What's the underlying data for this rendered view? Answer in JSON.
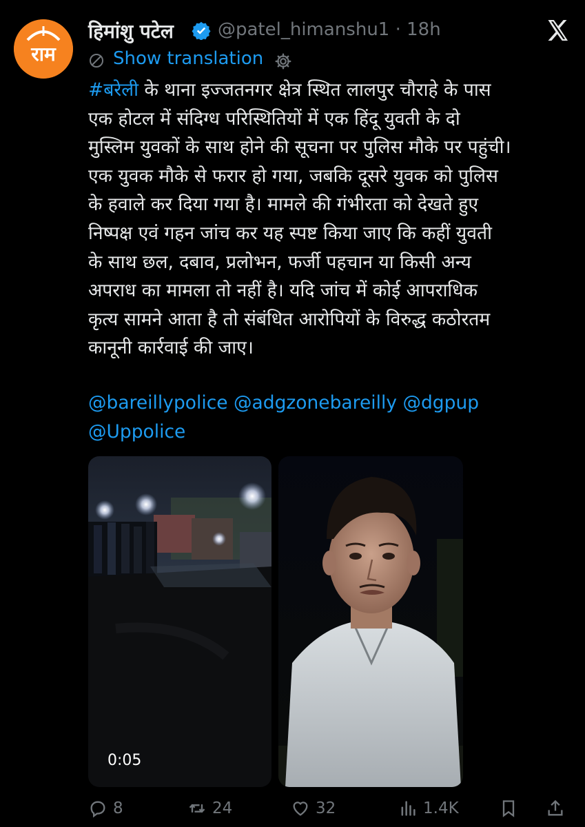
{
  "post": {
    "author_name": "हिमांशु पटेल",
    "author_handle": "@patel_himanshu1",
    "separator": "·",
    "time_ago": "18h",
    "avatar_text": "राम",
    "verified": true,
    "show_translation": "Show translation",
    "body_lines": [
      {
        "hashtag": "#बरेली",
        "text": " के थाना इज्जतनगर क्षेत्र स्थित लालपुर चौराहे के पास"
      },
      {
        "hashtag": "",
        "text": "एक होटल में संदिग्ध परिस्थितियों में एक हिंदू युवती के दो"
      },
      {
        "hashtag": "",
        "text": "मुस्लिम युवकों के साथ होने की सूचना पर पुलिस मौके पर पहुंची।"
      },
      {
        "hashtag": "",
        "text": "एक युवक मौके से फरार हो गया, जबकि दूसरे युवक को पुलिस"
      },
      {
        "hashtag": "",
        "text": "के हवाले कर दिया गया है। मामले की गंभीरता को देखते हुए"
      },
      {
        "hashtag": "",
        "text": "निष्पक्ष एवं गहन जांच कर यह स्पष्ट किया जाए कि कहीं युवती"
      },
      {
        "hashtag": "",
        "text": "के साथ छल, दबाव, प्रलोभन, फर्जी पहचान या किसी अन्य"
      },
      {
        "hashtag": "",
        "text": "अपराध का मामला तो नहीं है। यदि जांच में कोई आपराधिक"
      },
      {
        "hashtag": "",
        "text": "कृत्य सामने आता है तो संबंधित आरोपियों के विरुद्ध कठोरतम"
      },
      {
        "hashtag": "",
        "text": "कानूनी कार्रवाई की जाए।"
      }
    ],
    "mentions_line1": "@bareillypolice @adgzonebareilly @dgpup",
    "mentions_line2": "@Uppolice",
    "media": [
      {
        "kind": "video",
        "duration": "0:05",
        "scene": "night-street-crowd"
      },
      {
        "kind": "photo",
        "scene": "young-man-portrait"
      }
    ]
  },
  "actions": {
    "reply_count": "8",
    "repost_count": "24",
    "like_count": "32",
    "views_count": "1.4K",
    "icons": [
      "reply-icon",
      "repost-icon",
      "like-icon",
      "views-icon",
      "bookmark-icon",
      "share-icon"
    ]
  },
  "colors": {
    "background": "#000000",
    "text": "#e7e9ea",
    "muted": "#71767b",
    "link": "#1d9bf0",
    "avatar": "#f6821f"
  }
}
